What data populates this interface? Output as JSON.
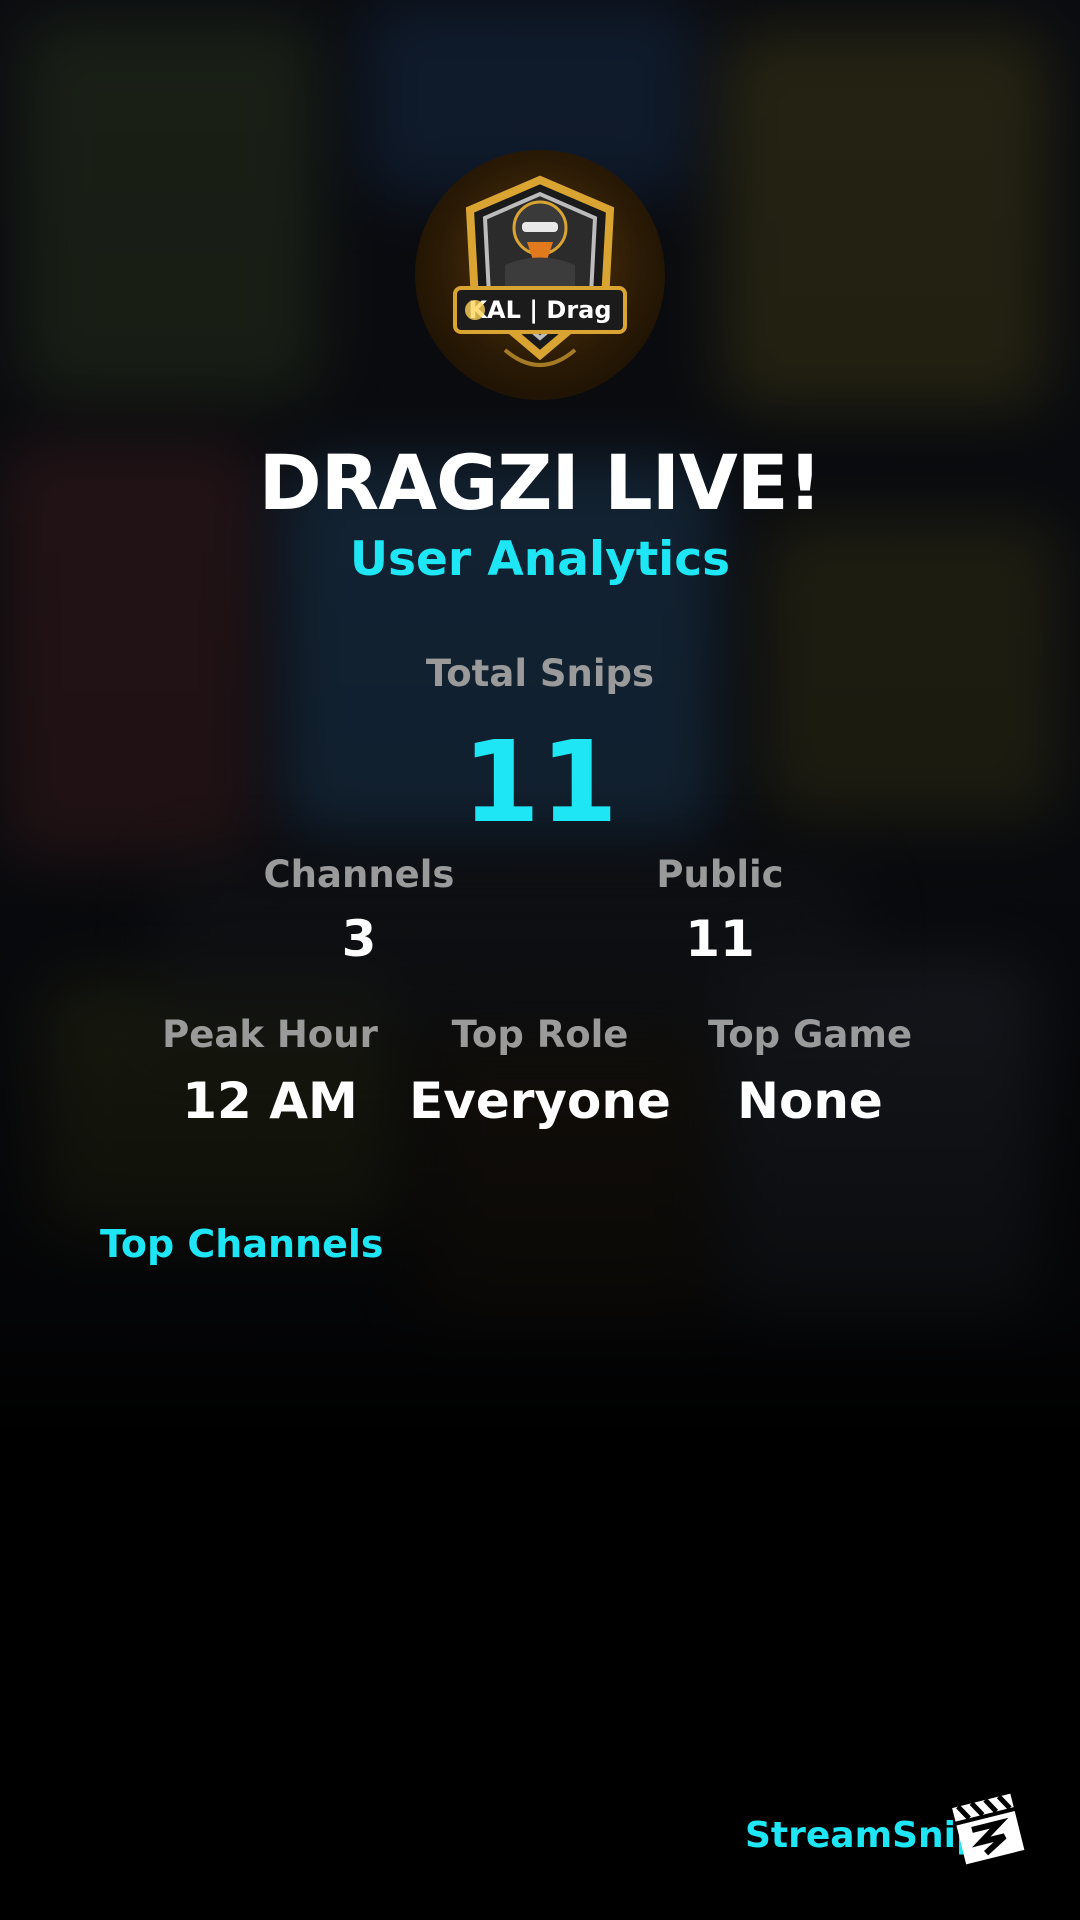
{
  "profile": {
    "avatar_text": "KAL | Drag",
    "title": "DRAGZI LIVE!",
    "subtitle": "User Analytics"
  },
  "total": {
    "label": "Total Snips",
    "value": "11"
  },
  "stats_row1": [
    {
      "label": "Channels",
      "value": "3"
    },
    {
      "label": "Public",
      "value": "11"
    }
  ],
  "stats_row2": [
    {
      "label": "Peak Hour",
      "value": "12 AM"
    },
    {
      "label": "Top Role",
      "value": "Everyone"
    },
    {
      "label": "Top Game",
      "value": "None"
    }
  ],
  "top_channels": {
    "title": "Top Channels"
  },
  "footer": {
    "brand": "StreamSnip",
    "logo_icon": "clapperboard-icon"
  },
  "colors": {
    "accent": "#1ee6f5",
    "label": "#9a9a9a",
    "background": "#000000"
  }
}
